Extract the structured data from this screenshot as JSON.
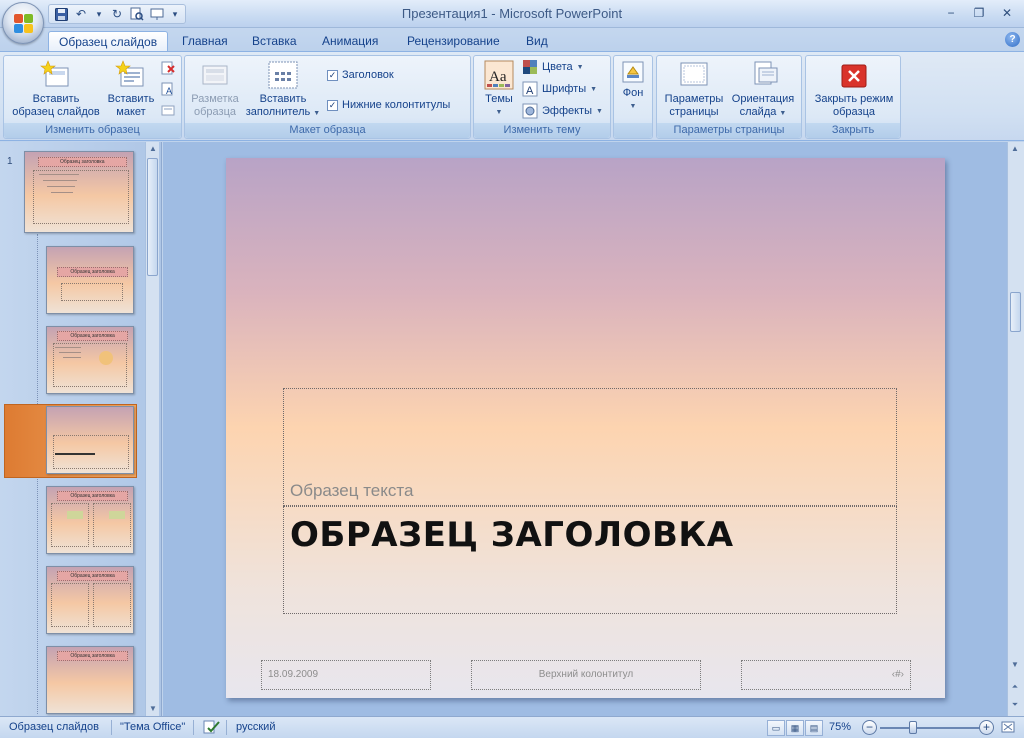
{
  "window": {
    "title": "Презентация1 - Microsoft PowerPoint",
    "minimize": "−",
    "restore": "❐",
    "close": "✕"
  },
  "tabs": [
    {
      "label": "Образец слайдов",
      "active": true
    },
    {
      "label": "Главная"
    },
    {
      "label": "Вставка"
    },
    {
      "label": "Анимация"
    },
    {
      "label": "Рецензирование"
    },
    {
      "label": "Вид"
    }
  ],
  "ribbon": {
    "groups": [
      {
        "label": "Изменить образец"
      },
      {
        "label": "Макет образца"
      },
      {
        "label": "Изменить тему"
      },
      {
        "label": ""
      },
      {
        "label": "Параметры страницы"
      },
      {
        "label": "Закрыть"
      }
    ],
    "insert_master": {
      "line1": "Вставить",
      "line2": "образец слайдов"
    },
    "insert_layout": {
      "line1": "Вставить",
      "line2": "макет"
    },
    "master_layout": {
      "line1": "Разметка",
      "line2": "образца"
    },
    "insert_placeholder": {
      "line1": "Вставить",
      "line2": "заполнитель"
    },
    "title_checkbox": {
      "label": "Заголовок",
      "checked": true
    },
    "footers_checkbox": {
      "label": "Нижние колонтитулы",
      "checked": true
    },
    "themes": {
      "label": "Темы"
    },
    "colors": {
      "label": "Цвета"
    },
    "fonts": {
      "label": "Шрифты"
    },
    "effects": {
      "label": "Эффекты"
    },
    "background": {
      "label": "Фон"
    },
    "page_setup": {
      "line1": "Параметры",
      "line2": "страницы"
    },
    "orientation": {
      "line1": "Ориентация",
      "line2": "слайда"
    },
    "close_master": {
      "line1": "Закрыть режим",
      "line2": "образца"
    }
  },
  "thumbnails": {
    "first_number": "1",
    "master_title": "Образец заголовка"
  },
  "slide": {
    "subtitle": "Образец текста",
    "title": "ОБРАЗЕЦ ЗАГОЛОВКА",
    "date": "18.09.2009",
    "footer": "Верхний колонтитул",
    "slide_number": "‹#›"
  },
  "statusbar": {
    "view_name": "Образец слайдов",
    "theme": "\"Тема Office\"",
    "language": "русский",
    "zoom": "75%"
  },
  "colors": {
    "accent_selected": "#e58a3e",
    "close_red": "#d9332b"
  }
}
